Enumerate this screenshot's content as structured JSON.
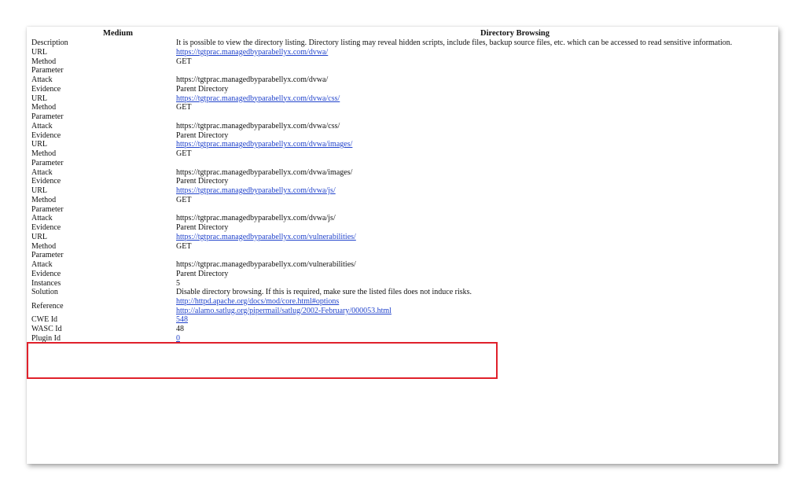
{
  "header": {
    "risk": "Medium",
    "alert": "Directory Browsing"
  },
  "rows": [
    {
      "label": "Description",
      "value": "It is possible to view the directory listing. Directory listing may reveal hidden scripts, include files, backup source files, etc. which can be accessed to read sensitive information.",
      "link": false
    },
    {
      "label": "URL",
      "value": "https://tgtprac.managedbyparabellyx.com/dvwa/",
      "link": true
    },
    {
      "label": "Method",
      "value": "GET",
      "link": false
    },
    {
      "label": "Parameter",
      "value": "",
      "link": false
    },
    {
      "label": "Attack",
      "value": "https://tgtprac.managedbyparabellyx.com/dvwa/",
      "link": false
    },
    {
      "label": "Evidence",
      "value": "Parent Directory",
      "link": false
    },
    {
      "label": "URL",
      "value": "https://tgtprac.managedbyparabellyx.com/dvwa/css/",
      "link": true
    },
    {
      "label": "Method",
      "value": "GET",
      "link": false
    },
    {
      "label": "Parameter",
      "value": "",
      "link": false
    },
    {
      "label": "Attack",
      "value": "https://tgtprac.managedbyparabellyx.com/dvwa/css/",
      "link": false
    },
    {
      "label": "Evidence",
      "value": "Parent Directory",
      "link": false
    },
    {
      "label": "URL",
      "value": "https://tgtprac.managedbyparabellyx.com/dvwa/images/",
      "link": true
    },
    {
      "label": "Method",
      "value": "GET",
      "link": false
    },
    {
      "label": "Parameter",
      "value": "",
      "link": false
    },
    {
      "label": "Attack",
      "value": "https://tgtprac.managedbyparabellyx.com/dvwa/images/",
      "link": false
    },
    {
      "label": "Evidence",
      "value": "Parent Directory",
      "link": false
    },
    {
      "label": "URL",
      "value": "https://tgtprac.managedbyparabellyx.com/dvwa/js/",
      "link": true
    },
    {
      "label": "Method",
      "value": "GET",
      "link": false
    },
    {
      "label": "Parameter",
      "value": "",
      "link": false
    },
    {
      "label": "Attack",
      "value": "https://tgtprac.managedbyparabellyx.com/dvwa/js/",
      "link": false
    },
    {
      "label": "Evidence",
      "value": "Parent Directory",
      "link": false
    },
    {
      "label": "URL",
      "value": "https://tgtprac.managedbyparabellyx.com/vulnerabilities/",
      "link": true
    },
    {
      "label": "Method",
      "value": "GET",
      "link": false
    },
    {
      "label": "Parameter",
      "value": "",
      "link": false
    },
    {
      "label": "Attack",
      "value": "https://tgtprac.managedbyparabellyx.com/vulnerabilities/",
      "link": false
    },
    {
      "label": "Evidence",
      "value": "Parent Directory",
      "link": false
    },
    {
      "label": "Instances",
      "value": "5",
      "link": false
    },
    {
      "label": "Solution",
      "value": "Disable directory browsing. If this is required, make sure the listed files does not induce risks.",
      "link": false
    }
  ],
  "reference": {
    "label": "Reference",
    "links": [
      "http://httpd.apache.org/docs/mod/core.html#options",
      "http://alamo.satlug.org/pipermail/satlug/2002-February/000053.html"
    ]
  },
  "tail_rows": [
    {
      "label": "CWE Id",
      "value": "548",
      "link": true
    },
    {
      "label": "WASC Id",
      "value": "48",
      "link": false
    },
    {
      "label": "Plugin Id",
      "value": "0",
      "link": true
    }
  ],
  "colors": {
    "link": "#2244cc",
    "highlight_box": "#e0212b",
    "text": "#111111"
  }
}
